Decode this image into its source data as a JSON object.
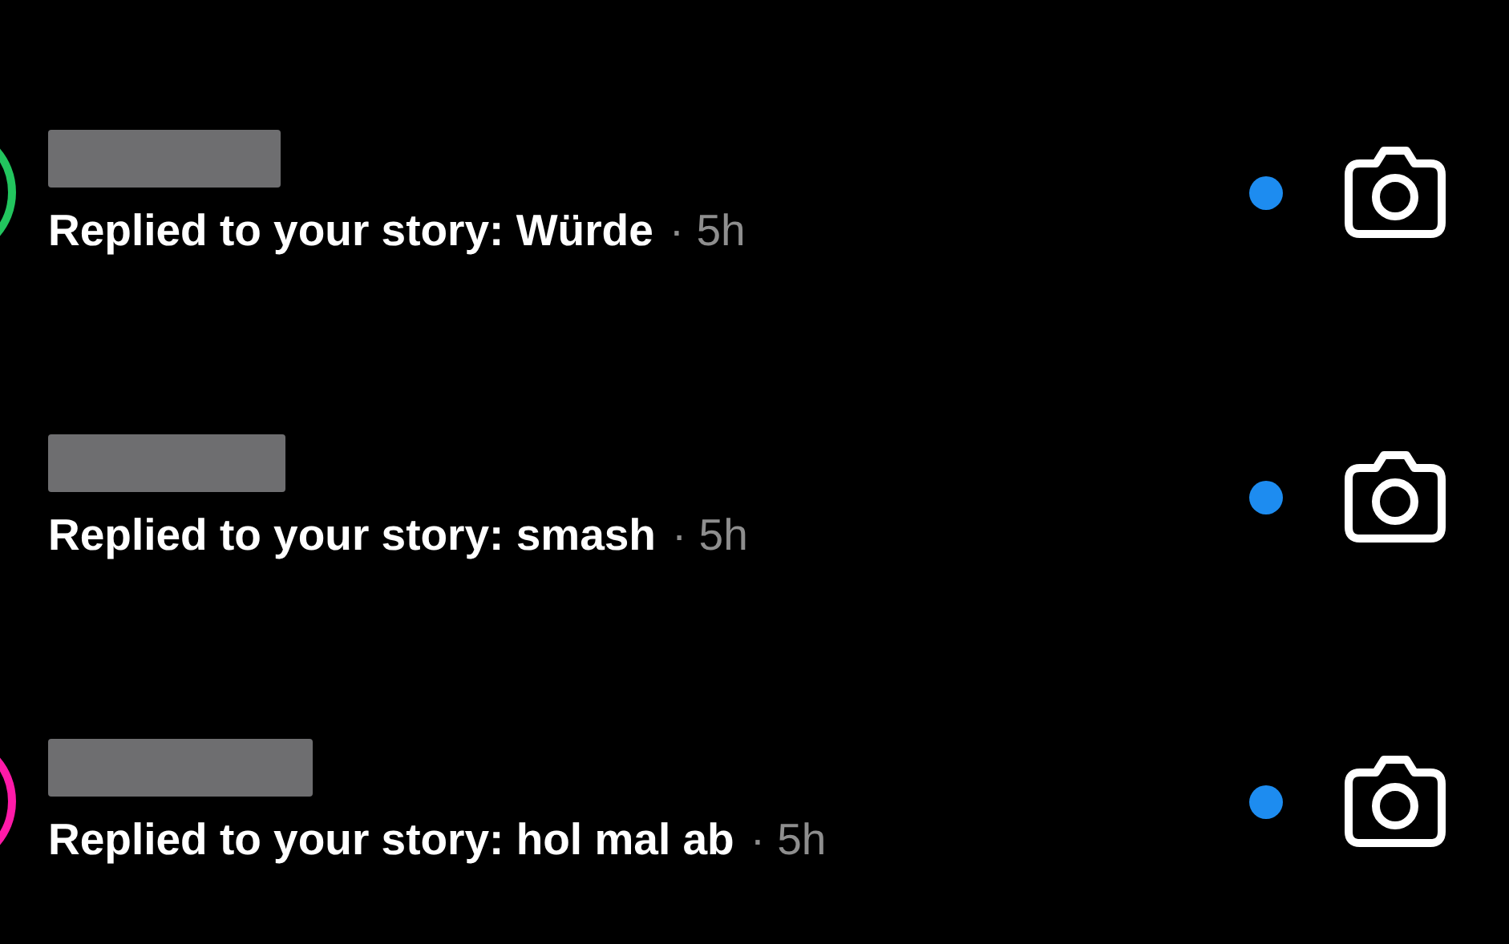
{
  "notifications": [
    {
      "message": "Replied to your story: Würde",
      "time": "· 5h",
      "color": "#22c55e",
      "unread": true
    },
    {
      "message": "Replied to your story: smash",
      "time": "· 5h",
      "unread": true
    },
    {
      "message": "Replied to your story: hol mal ab",
      "time": "· 5h",
      "color": "#ff1aa8",
      "unread": true
    }
  ]
}
